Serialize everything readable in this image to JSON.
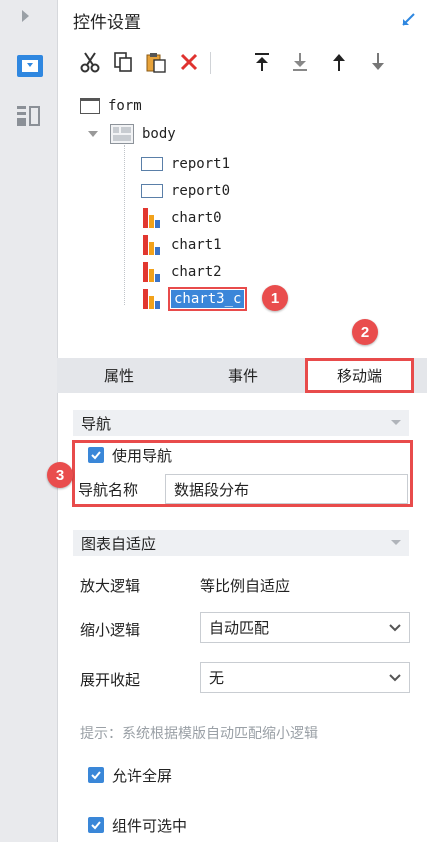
{
  "panel": {
    "title": "控件设置"
  },
  "toolbar": {
    "buttons": [
      "cut-icon",
      "copy-icon",
      "paste-icon",
      "delete-icon",
      "move-top-icon",
      "move-bottom-icon",
      "move-up-icon",
      "move-down-icon"
    ]
  },
  "tree": {
    "nodes": [
      "form",
      "body",
      "report1",
      "report0",
      "chart0",
      "chart1",
      "chart2",
      "chart3_c"
    ],
    "selected": "chart3_c"
  },
  "annotations": {
    "badge1": "1",
    "badge2": "2",
    "badge3": "3"
  },
  "tabs": {
    "attributes": "属性",
    "events": "事件",
    "mobile": "移动端"
  },
  "nav": {
    "header": "导航",
    "use_nav_label": "使用导航",
    "use_nav_checked": true,
    "name_label": "导航名称",
    "name_value": "数据段分布"
  },
  "adapt": {
    "header": "图表自适应",
    "zoom_in_label": "放大逻辑",
    "zoom_in_value": "等比例自适应",
    "zoom_out_label": "缩小逻辑",
    "zoom_out_value": "自动匹配",
    "expand_label": "展开收起",
    "expand_value": "无",
    "hint": "提示：系统根据模版自动匹配缩小逻辑",
    "fullscreen_label": "允许全屏",
    "fullscreen_checked": true,
    "selectable_label": "组件可选中",
    "selectable_checked": true
  },
  "colors": {
    "accent": "#3a87d8",
    "highlight": "#e84b4b"
  }
}
